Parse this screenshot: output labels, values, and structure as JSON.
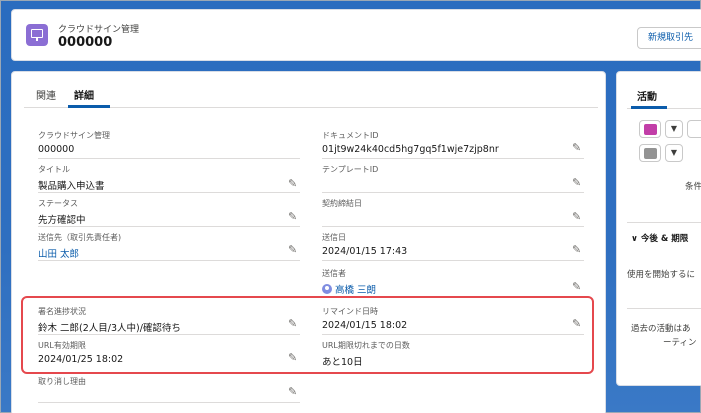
{
  "header": {
    "object_type": "クラウドサイン管理",
    "record_name": "000000",
    "new_button_label": "新規取引先"
  },
  "tabs": [
    {
      "label": "関連"
    },
    {
      "label": "詳細"
    }
  ],
  "fields": {
    "cloudsign_mgmt": {
      "label": "クラウドサイン管理",
      "value": "000000"
    },
    "document_id": {
      "label": "ドキュメントID",
      "value": "01jt9w24k40cd5hg7gq5f1wje7zjp8nr"
    },
    "title": {
      "label": "タイトル",
      "value": "製品購入申込書"
    },
    "template_id": {
      "label": "テンプレートID",
      "value": ""
    },
    "status": {
      "label": "ステータス",
      "value": "先方確認中"
    },
    "contract_date": {
      "label": "契約締結日",
      "value": ""
    },
    "recipient": {
      "label": "送信先（取引先責任者)",
      "value": "山田 太郎"
    },
    "sent_date": {
      "label": "送信日",
      "value": "2024/01/15 17:43"
    },
    "sender": {
      "label": "送信者",
      "value": "高橋 三朗"
    },
    "sign_progress": {
      "label": "署名進捗状況",
      "value": "鈴木 二郎(2人目/3人中)/確認待ち"
    },
    "remind_date": {
      "label": "リマインド日時",
      "value": "2024/01/15 18:02"
    },
    "url_expiry": {
      "label": "URL有効期限",
      "value": "2024/01/25 18:02"
    },
    "days_until_expiry": {
      "label": "URL期限切れまでの日数",
      "value": "あと10日"
    },
    "cancel_reason": {
      "label": "取り消し理由",
      "value": ""
    }
  },
  "side": {
    "title": "活動",
    "text_partial": "条件",
    "upcoming_label": "今後 & 期限",
    "start_text": "使用を開始するに",
    "past_text_1": "過去の活動はあ",
    "past_text_2": "ーティン"
  },
  "colors": {
    "accent": "#0b5cab",
    "highlight": "#e5484d",
    "object_icon": "#8b6ed4",
    "event_icon": "#c23ea8",
    "email_icon": "#939393"
  }
}
